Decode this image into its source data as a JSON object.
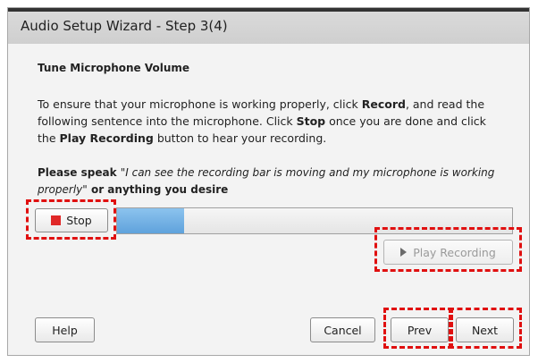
{
  "window": {
    "title": "Audio Setup Wizard - Step 3(4)"
  },
  "content": {
    "heading": "Tune Microphone Volume",
    "instruction": {
      "t1": "To ensure that your microphone is working properly, click ",
      "record": "Record",
      "t2": ", and read the following sentence into the microphone. Click ",
      "stop": "Stop",
      "t3": " once you are done and click the ",
      "play": "Play Recording",
      "t4": " button to hear your recording."
    },
    "speak": {
      "prefix": "Please speak ",
      "quote": "\"I can see the recording bar is moving and my microphone is working properly\"",
      "suffix": " or anything you desire"
    }
  },
  "recorder": {
    "stop_label": "Stop",
    "level": 0.17,
    "play_label": "Play Recording",
    "stop_color": "#e02828",
    "bar_color": "#5fa2dc"
  },
  "footer": {
    "help_label": "Help",
    "cancel_label": "Cancel",
    "prev_label": "Prev",
    "next_label": "Next"
  },
  "highlight_color": "#e01010"
}
